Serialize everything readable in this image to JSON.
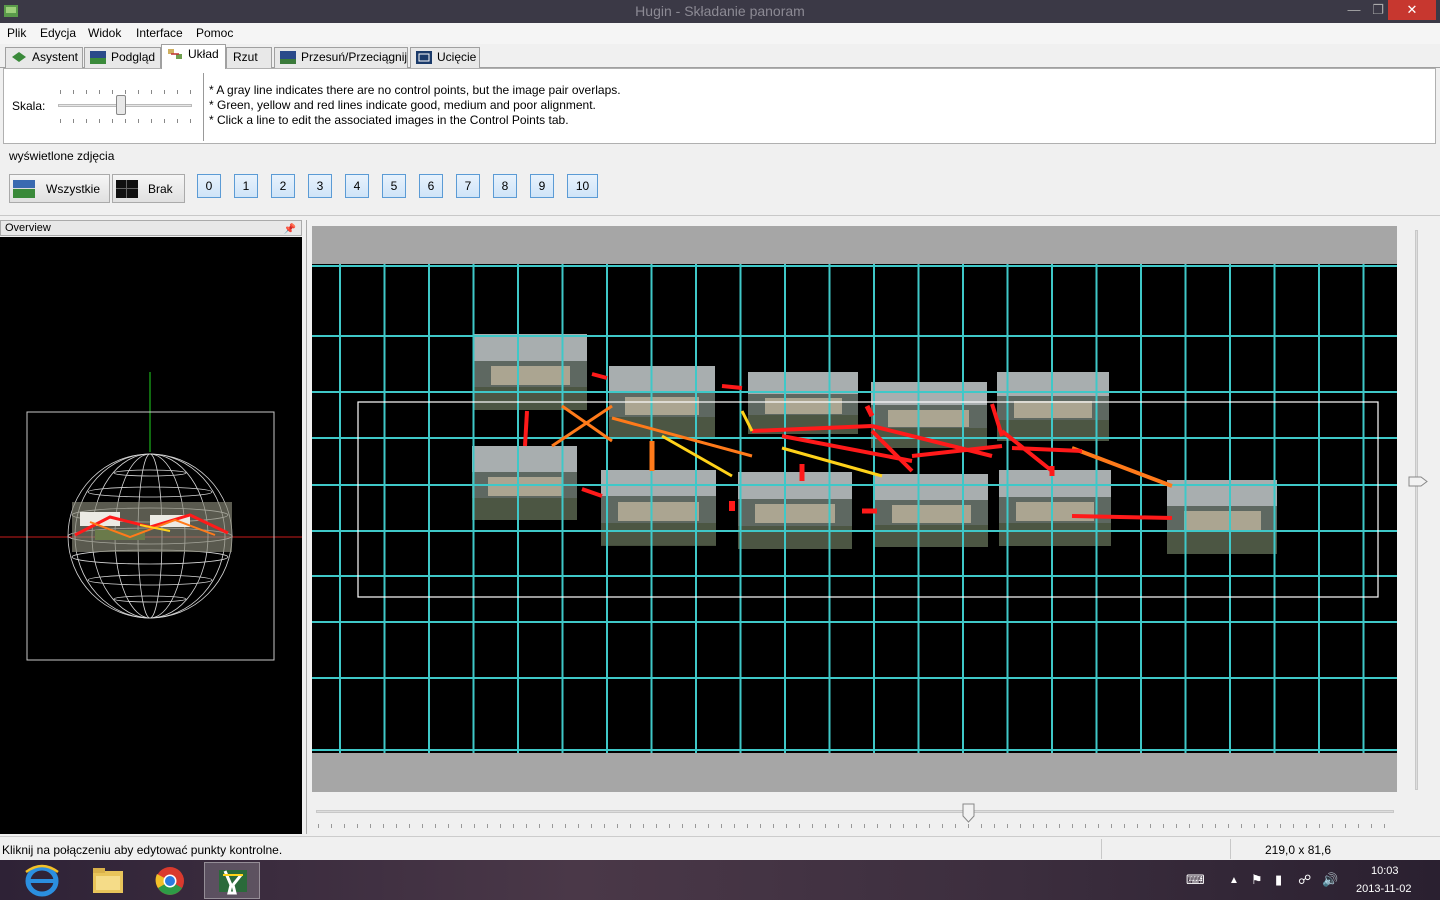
{
  "window": {
    "title": "Hugin - Składanie panoram"
  },
  "menu": [
    "Plik",
    "Edycja",
    "Widok",
    "Interface",
    "Pomoc"
  ],
  "tabs": [
    {
      "label": "Asystent"
    },
    {
      "label": "Podgląd"
    },
    {
      "label": "Układ",
      "active": true
    },
    {
      "label": "Rzut"
    },
    {
      "label": "Przesuń/Przeciągnij"
    },
    {
      "label": "Ucięcie"
    }
  ],
  "layout_panel": {
    "scale_label": "Skala:",
    "scale_level": 0.47,
    "info_lines": [
      "* A gray line indicates there are no control points, but the image pair overlaps.",
      "* Green, yellow and red lines indicate good, medium and poor alignment.",
      "* Click a line to edit the associated images in the Control Points tab."
    ]
  },
  "images": {
    "label": "wyświetlone zdjęcia",
    "all_button": "Wszystkie",
    "none_button": "Brak",
    "numbers": [
      "0",
      "1",
      "2",
      "3",
      "4",
      "5",
      "6",
      "7",
      "8",
      "9",
      "10"
    ]
  },
  "overview": {
    "title": "Overview"
  },
  "status": {
    "message": "Kliknij na połączeniu aby edytować punkty kontrolne.",
    "dimensions": "219,0 x 81,6"
  },
  "taskbar": {
    "apps": [
      "internet-explorer",
      "file-explorer",
      "chrome",
      "hugin"
    ],
    "time": "10:03",
    "date": "2013-11-02"
  },
  "colors": {
    "grid": "#3fc8c8",
    "link_poor": "#ff1a1a",
    "link_medium": "#ff7a1a",
    "link_good": "#ffd21a",
    "button_accent": "#5b9bd5"
  }
}
